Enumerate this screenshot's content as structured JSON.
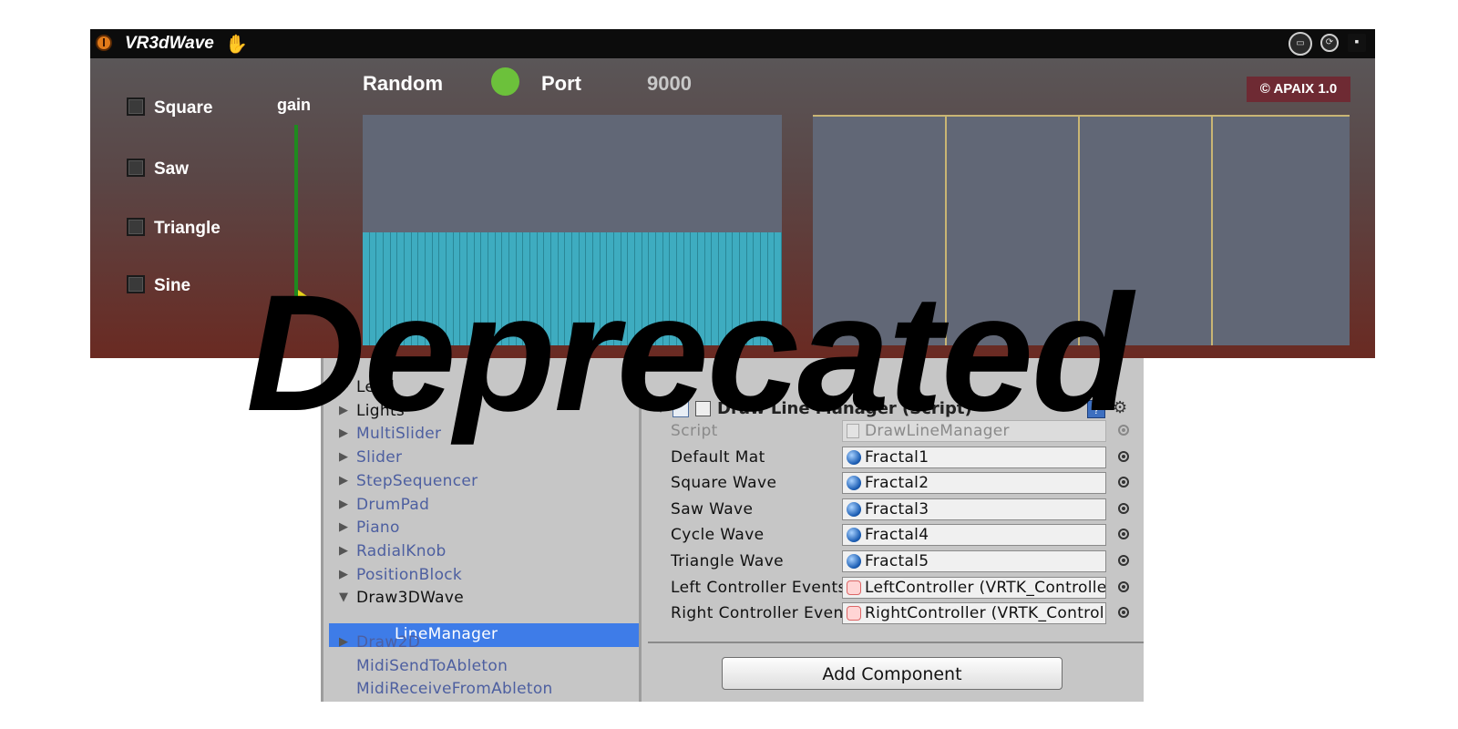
{
  "patch": {
    "title": "VR3dWave",
    "checkboxes": [
      {
        "label": "Square",
        "checked": false
      },
      {
        "label": "Saw",
        "checked": false
      },
      {
        "label": "Triangle",
        "checked": false
      },
      {
        "label": "Sine",
        "checked": false
      }
    ],
    "gain_label": "gain",
    "random_label": "Random",
    "random_led_color": "#6cc13b",
    "port_label": "Port",
    "port_value": "9000",
    "copyright": "© APAIX 1.0",
    "multislider_level": 0.49,
    "multislider_count": 60,
    "accent_colors": {
      "bars": "#3eacc0",
      "grid": "#c9b574",
      "gain": "#1f8a1f"
    }
  },
  "hierarchy": {
    "items": [
      {
        "label": "Lead",
        "arrow": "▶",
        "dark": true
      },
      {
        "label": "Lights",
        "arrow": "▶",
        "dark": true
      },
      {
        "label": "MultiSlider",
        "arrow": "▶",
        "dark": false
      },
      {
        "label": "Slider",
        "arrow": "▶",
        "dark": false
      },
      {
        "label": "StepSequencer",
        "arrow": "▶",
        "dark": false
      },
      {
        "label": "DrumPad",
        "arrow": "▶",
        "dark": false
      },
      {
        "label": "Piano",
        "arrow": "▶",
        "dark": false
      },
      {
        "label": "RadialKnob",
        "arrow": "▶",
        "dark": false
      },
      {
        "label": "PositionBlock",
        "arrow": "▶",
        "dark": false
      },
      {
        "label": "Draw3DWave",
        "arrow": "▼",
        "dark": true
      }
    ],
    "selected": "LineManager",
    "after_items": [
      {
        "label": "Draw2D",
        "arrow": "▶",
        "dark": false
      },
      {
        "label": "MidiSendToAbleton",
        "arrow": "",
        "dark": false
      },
      {
        "label": "MidiReceiveFromAbleton",
        "arrow": "",
        "dark": false
      }
    ]
  },
  "inspector": {
    "component_title": "Draw Line Manager (Script)",
    "help": "?",
    "gear": "⚙",
    "properties": [
      {
        "label": "Script",
        "value": "DrawLineManager",
        "icon": "script-icon",
        "disabled": true
      },
      {
        "label": "Default Mat",
        "value": "Fractal1",
        "icon": "material-icon",
        "disabled": false
      },
      {
        "label": "Square Wave",
        "value": "Fractal2",
        "icon": "material-icon",
        "disabled": false
      },
      {
        "label": "Saw Wave",
        "value": "Fractal3",
        "icon": "material-icon",
        "disabled": false
      },
      {
        "label": "Cycle Wave",
        "value": "Fractal4",
        "icon": "material-icon",
        "disabled": false
      },
      {
        "label": "Triangle Wave",
        "value": "Fractal5",
        "icon": "material-icon",
        "disabled": false
      },
      {
        "label": "Left Controller Events",
        "value": "LeftController (VRTK_Controller_Events)",
        "icon": "controller-icon",
        "disabled": false
      },
      {
        "label": "Right Controller Events",
        "value": "RightController (VRTK_Controller_Events)",
        "icon": "controller-icon",
        "disabled": false
      }
    ],
    "add_component": "Add Component"
  },
  "overlay": "Deprecated"
}
